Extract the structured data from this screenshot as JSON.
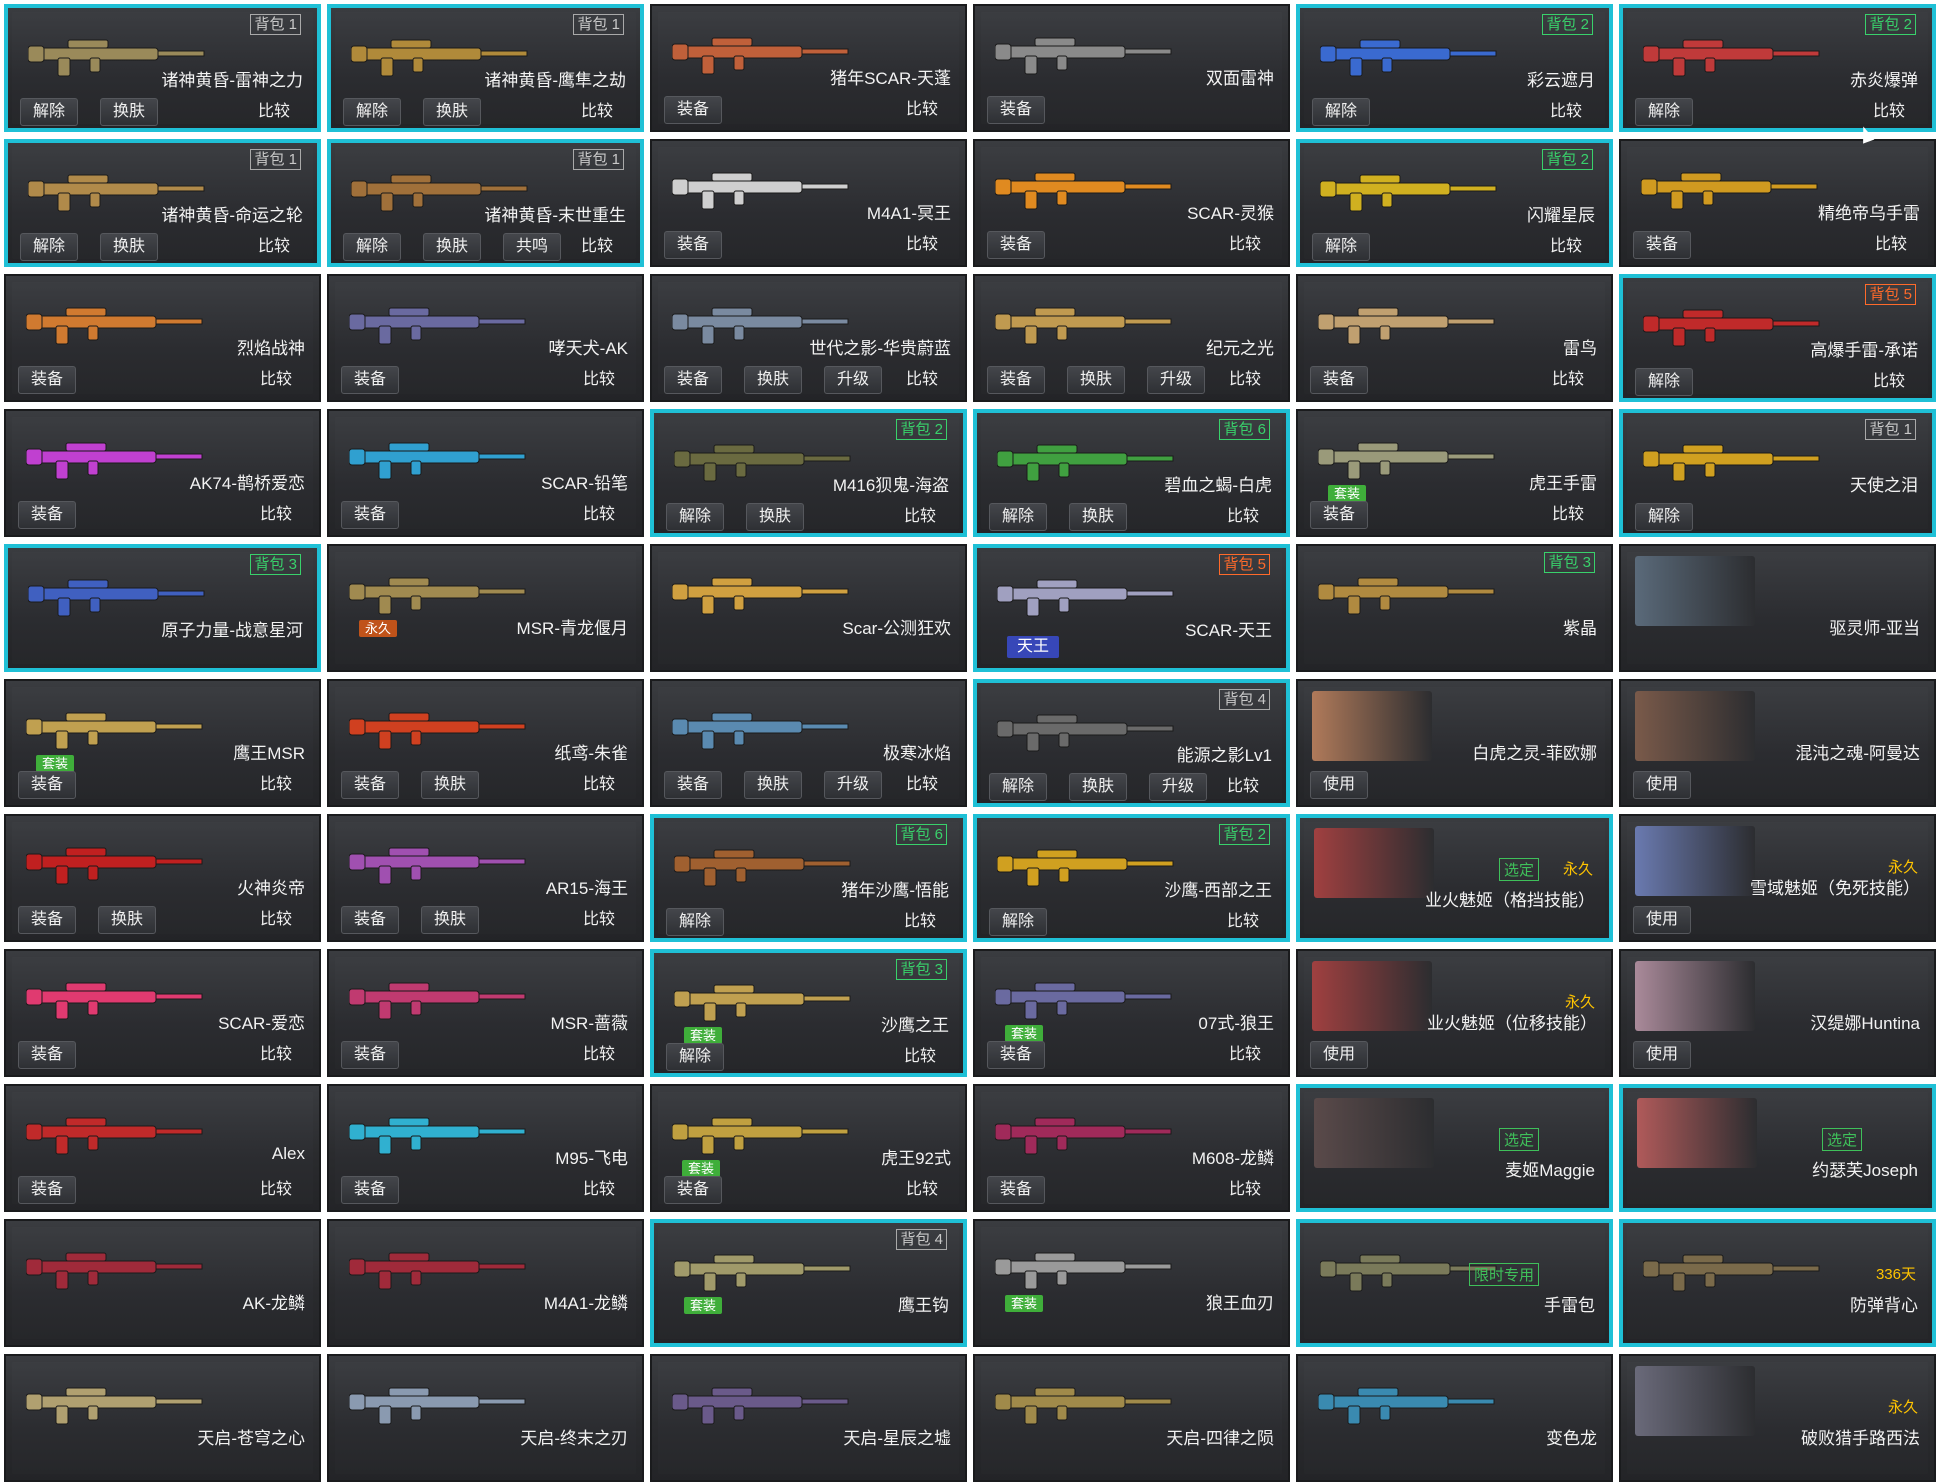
{
  "cards": [
    {
      "name": "诸神黄昏-雷神之力",
      "tag": "背包 1",
      "tag_color": "gray",
      "selected": true,
      "buttons": [
        "解除",
        "换肤",
        "比较"
      ],
      "color": "#9a8a5a"
    },
    {
      "name": "诸神黄昏-鹰隼之劫",
      "tag": "背包 1",
      "tag_color": "gray",
      "selected": true,
      "buttons": [
        "解除",
        "换肤",
        "比较"
      ],
      "color": "#b08a3a"
    },
    {
      "name": "猪年SCAR-天蓬",
      "tag": "",
      "tag_color": "",
      "selected": false,
      "buttons": [
        "装备",
        "比较"
      ],
      "color": "#c0603a"
    },
    {
      "name": "双面雷神",
      "tag": "",
      "tag_color": "",
      "selected": false,
      "buttons": [
        "装备"
      ],
      "color": "#8a8a8a"
    },
    {
      "name": "彩云遮月",
      "tag": "背包 2",
      "tag_color": "green",
      "selected": true,
      "buttons": [
        "解除",
        "比较"
      ],
      "color": "#3a6ad0"
    },
    {
      "name": "赤炎爆弹",
      "tag": "背包 2",
      "tag_color": "green",
      "selected": true,
      "buttons": [
        "解除",
        "比较"
      ],
      "color": "#c03a3a"
    },
    {
      "name": "诸神黄昏-命运之轮",
      "tag": "背包 1",
      "tag_color": "gray",
      "selected": true,
      "buttons": [
        "解除",
        "换肤",
        "比较"
      ],
      "color": "#b08a4a"
    },
    {
      "name": "诸神黄昏-末世重生",
      "tag": "背包 1",
      "tag_color": "gray",
      "selected": true,
      "buttons": [
        "解除",
        "换肤",
        "共鸣",
        "比较"
      ],
      "color": "#a0703a"
    },
    {
      "name": "M4A1-冥王",
      "tag": "",
      "tag_color": "",
      "selected": false,
      "buttons": [
        "装备",
        "比较"
      ],
      "color": "#cfcfcf"
    },
    {
      "name": "SCAR-灵猴",
      "tag": "",
      "tag_color": "",
      "selected": false,
      "buttons": [
        "装备",
        "比较"
      ],
      "color": "#e08a20"
    },
    {
      "name": "闪耀星辰",
      "tag": "背包 2",
      "tag_color": "green",
      "selected": true,
      "buttons": [
        "解除",
        "比较"
      ],
      "color": "#d0b020"
    },
    {
      "name": "精绝帝乌手雷",
      "tag": "",
      "tag_color": "",
      "selected": false,
      "buttons": [
        "装备",
        "比较"
      ],
      "color": "#d09a20"
    },
    {
      "name": "烈焰战神",
      "tag": "",
      "tag_color": "",
      "selected": false,
      "buttons": [
        "装备",
        "比较"
      ],
      "color": "#d07a30"
    },
    {
      "name": "哮天犬-AK",
      "tag": "",
      "tag_color": "",
      "selected": false,
      "buttons": [
        "装备",
        "比较"
      ],
      "color": "#6a6aa0"
    },
    {
      "name": "世代之影-华贵蔚蓝",
      "tag": "",
      "tag_color": "",
      "selected": false,
      "buttons": [
        "装备",
        "换肤",
        "升级",
        "比较"
      ],
      "color": "#7a8aa0"
    },
    {
      "name": "纪元之光",
      "tag": "",
      "tag_color": "",
      "selected": false,
      "buttons": [
        "装备",
        "换肤",
        "升级",
        "比较"
      ],
      "color": "#c09a50"
    },
    {
      "name": "雷鸟",
      "tag": "",
      "tag_color": "",
      "selected": false,
      "buttons": [
        "装备",
        "比较"
      ],
      "color": "#c0a070"
    },
    {
      "name": "高爆手雷-承诺",
      "tag": "背包 5",
      "tag_color": "orange",
      "selected": true,
      "buttons": [
        "解除",
        "比较"
      ],
      "color": "#c02a2a"
    },
    {
      "name": "AK74-鹊桥爱恋",
      "tag": "",
      "tag_color": "",
      "selected": false,
      "buttons": [
        "装备",
        "比较"
      ],
      "color": "#c040d0"
    },
    {
      "name": "SCAR-铅笔",
      "tag": "",
      "tag_color": "",
      "selected": false,
      "buttons": [
        "装备",
        "比较"
      ],
      "color": "#30a0d0"
    },
    {
      "name": "M416狈鬼-海盗",
      "tag": "背包 2",
      "tag_color": "green",
      "selected": true,
      "buttons": [
        "解除",
        "换肤",
        "比较"
      ],
      "color": "#6a6a40"
    },
    {
      "name": "碧血之蝎-白虎",
      "tag": "背包 6",
      "tag_color": "green",
      "selected": true,
      "buttons": [
        "解除",
        "换肤",
        "比较"
      ],
      "color": "#40a040"
    },
    {
      "name": "虎王手雷",
      "tag": "",
      "tag_color": "",
      "selected": false,
      "buttons": [
        "装备",
        "比较"
      ],
      "badge": "套装",
      "color": "#9a9a7a"
    },
    {
      "name": "天使之泪",
      "tag": "背包 1",
      "tag_color": "gray",
      "selected": true,
      "buttons": [
        "解除"
      ],
      "color": "#d0a020"
    },
    {
      "name": "原子力量-战意星河",
      "tag": "背包 3",
      "tag_color": "green",
      "selected": true,
      "buttons": [],
      "color": "#4060c0"
    },
    {
      "name": "MSR-青龙偃月",
      "tag": "",
      "tag_color": "",
      "selected": false,
      "buttons": [],
      "badge": "永久",
      "badge_style": "perm2",
      "color": "#a08a50"
    },
    {
      "name": "Scar-公测狂欢",
      "tag": "",
      "tag_color": "",
      "selected": false,
      "buttons": [],
      "color": "#d0a040"
    },
    {
      "name": "SCAR-天王",
      "tag": "背包 5",
      "tag_color": "orange",
      "selected": true,
      "buttons": [],
      "badge": "天王",
      "badge_style": "king",
      "color": "#a0a0c0"
    },
    {
      "name": "紫晶",
      "tag": "背包 3",
      "tag_color": "green",
      "selected": false,
      "buttons": [],
      "color": "#b08a40"
    },
    {
      "name": "驱灵师-亚当",
      "tag": "",
      "tag_color": "",
      "selected": false,
      "buttons": [],
      "portrait": true,
      "color": "#5a6a7a"
    },
    {
      "name": "鹰王MSR",
      "tag": "",
      "tag_color": "",
      "selected": false,
      "buttons": [
        "装备",
        "比较"
      ],
      "badge": "套装",
      "color": "#c0a050"
    },
    {
      "name": "纸鸢-朱雀",
      "tag": "",
      "tag_color": "",
      "selected": false,
      "buttons": [
        "装备",
        "换肤",
        "比较"
      ],
      "color": "#d04020"
    },
    {
      "name": "极寒冰焰",
      "tag": "",
      "tag_color": "",
      "selected": false,
      "buttons": [
        "装备",
        "换肤",
        "升级",
        "比较"
      ],
      "color": "#5a8ab0"
    },
    {
      "name": "能源之影Lv1",
      "tag": "背包 4",
      "tag_color": "gray",
      "selected": true,
      "buttons": [
        "解除",
        "换肤",
        "升级",
        "比较"
      ],
      "color": "#6a6a6a"
    },
    {
      "name": "白虎之灵-菲欧娜",
      "tag": "",
      "tag_color": "",
      "selected": false,
      "buttons": [
        "使用"
      ],
      "portrait": true,
      "color": "#b07a5a"
    },
    {
      "name": "混沌之魂-阿曼达",
      "tag": "",
      "tag_color": "",
      "selected": false,
      "buttons": [
        "使用"
      ],
      "portrait": true,
      "color": "#7a5a4a"
    },
    {
      "name": "火神炎帝",
      "tag": "",
      "tag_color": "",
      "selected": false,
      "buttons": [
        "装备",
        "换肤",
        "比较"
      ],
      "color": "#c02020"
    },
    {
      "name": "AR15-海王",
      "tag": "",
      "tag_color": "",
      "selected": false,
      "buttons": [
        "装备",
        "换肤",
        "比较"
      ],
      "color": "#a050b0"
    },
    {
      "name": "猪年沙鹰-悟能",
      "tag": "背包 6",
      "tag_color": "green",
      "selected": true,
      "buttons": [
        "解除",
        "比较"
      ],
      "color": "#a06030"
    },
    {
      "name": "沙鹰-西部之王",
      "tag": "背包 2",
      "tag_color": "green",
      "selected": true,
      "buttons": [
        "解除",
        "比较"
      ],
      "color": "#d0a020"
    },
    {
      "name": "业火魅姬（格挡技能）",
      "tag": "",
      "tag_color": "",
      "selected": true,
      "buttons": [],
      "portrait": true,
      "sub": "永久",
      "stamp": "选定",
      "color": "#a04040"
    },
    {
      "name": "雪域魅姬（免死技能）",
      "tag": "",
      "tag_color": "",
      "selected": false,
      "buttons": [
        "使用"
      ],
      "portrait": true,
      "sub": "永久",
      "color": "#6a7ab0"
    },
    {
      "name": "SCAR-爱恋",
      "tag": "",
      "tag_color": "",
      "selected": false,
      "buttons": [
        "装备",
        "比较"
      ],
      "color": "#e03a70"
    },
    {
      "name": "MSR-蔷薇",
      "tag": "",
      "tag_color": "",
      "selected": false,
      "buttons": [
        "装备",
        "比较"
      ],
      "color": "#c03a70"
    },
    {
      "name": "沙鹰之王",
      "tag": "背包 3",
      "tag_color": "green",
      "selected": true,
      "buttons": [
        "解除",
        "比较"
      ],
      "badge": "套装",
      "color": "#c0a050"
    },
    {
      "name": "07式-狼王",
      "tag": "",
      "tag_color": "",
      "selected": false,
      "buttons": [
        "装备",
        "比较"
      ],
      "badge": "套装",
      "color": "#6a6aa0"
    },
    {
      "name": "业火魅姬（位移技能）",
      "tag": "",
      "tag_color": "",
      "selected": false,
      "buttons": [
        "使用"
      ],
      "portrait": true,
      "sub": "永久",
      "color": "#a04040"
    },
    {
      "name": "汉缇娜Huntina",
      "tag": "",
      "tag_color": "",
      "selected": false,
      "buttons": [
        "使用"
      ],
      "portrait": true,
      "color": "#aa8a9a"
    },
    {
      "name": "Alex",
      "tag": "",
      "tag_color": "",
      "selected": false,
      "buttons": [
        "装备",
        "比较"
      ],
      "color": "#c02a2a"
    },
    {
      "name": "M95-飞电",
      "tag": "",
      "tag_color": "",
      "selected": false,
      "buttons": [
        "装备",
        "比较"
      ],
      "color": "#30b0d0"
    },
    {
      "name": "虎王92式",
      "tag": "",
      "tag_color": "",
      "selected": false,
      "buttons": [
        "装备",
        "比较"
      ],
      "badge": "套装",
      "color": "#c0a040"
    },
    {
      "name": "M608-龙鳞",
      "tag": "",
      "tag_color": "",
      "selected": false,
      "buttons": [
        "装备",
        "比较"
      ],
      "color": "#a02a5a"
    },
    {
      "name": "麦姬Maggie",
      "tag": "",
      "tag_color": "",
      "selected": true,
      "buttons": [],
      "portrait": true,
      "stamp": "选定",
      "color": "#5a4a4a"
    },
    {
      "name": "约瑟芙Joseph",
      "tag": "",
      "tag_color": "",
      "selected": true,
      "buttons": [],
      "portrait": true,
      "stamp": "选定",
      "color": "#b05a5a"
    },
    {
      "name": "AK-龙鳞",
      "tag": "",
      "tag_color": "",
      "selected": false,
      "buttons": [],
      "color": "#a02a3a"
    },
    {
      "name": "M4A1-龙鳞",
      "tag": "",
      "tag_color": "",
      "selected": false,
      "buttons": [],
      "color": "#a02a3a"
    },
    {
      "name": "鹰王钩",
      "tag": "背包 4",
      "tag_color": "gray",
      "selected": true,
      "buttons": [],
      "badge": "套装",
      "color": "#a09a6a"
    },
    {
      "name": "狼王血刃",
      "tag": "",
      "tag_color": "",
      "selected": false,
      "buttons": [],
      "badge": "套装",
      "color": "#9a9a9a"
    },
    {
      "name": "手雷包",
      "tag": "",
      "tag_color": "",
      "selected": true,
      "buttons": [],
      "stamp": "限时专用",
      "color": "#7a7a5a"
    },
    {
      "name": "防弹背心",
      "tag": "",
      "tag_color": "",
      "selected": true,
      "buttons": [],
      "sub": "336天",
      "color": "#7a6a4a"
    },
    {
      "name": "天启-苍穹之心",
      "tag": "",
      "tag_color": "",
      "selected": false,
      "buttons": [],
      "color": "#b0a070"
    },
    {
      "name": "天启-终末之刃",
      "tag": "",
      "tag_color": "",
      "selected": false,
      "buttons": [],
      "color": "#8a9ab0"
    },
    {
      "name": "天启-星辰之墟",
      "tag": "",
      "tag_color": "",
      "selected": false,
      "buttons": [],
      "color": "#6a5a8a"
    },
    {
      "name": "天启-四律之陨",
      "tag": "",
      "tag_color": "",
      "selected": false,
      "buttons": [],
      "color": "#a08a4a"
    },
    {
      "name": "变色龙",
      "tag": "",
      "tag_color": "",
      "selected": false,
      "buttons": [],
      "color": "#3a8ab0"
    },
    {
      "name": "破败猎手路西法",
      "tag": "",
      "tag_color": "",
      "selected": false,
      "buttons": [],
      "portrait": true,
      "sub": "永久",
      "color": "#6a6a7a"
    }
  ]
}
